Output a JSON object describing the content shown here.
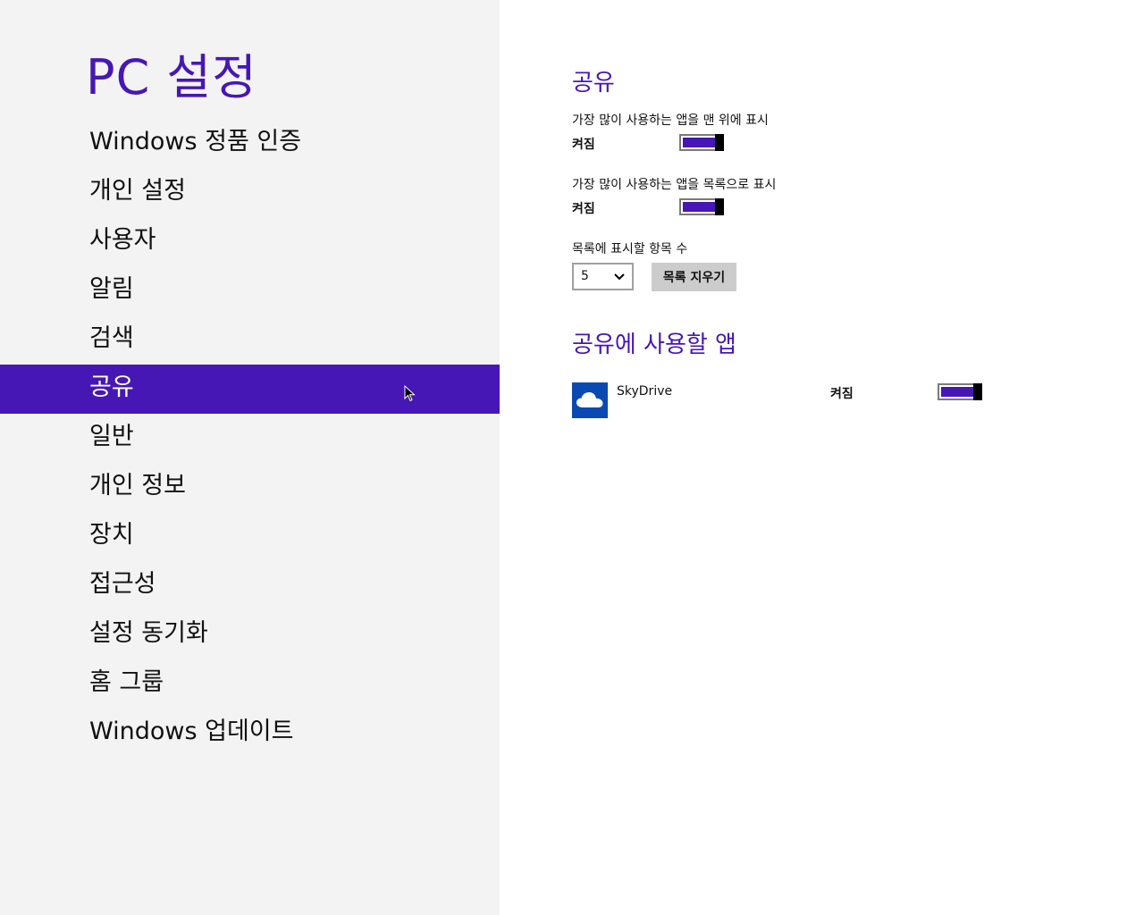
{
  "sidebar": {
    "title": "PC 설정",
    "items": [
      {
        "label": "Windows 정품 인증"
      },
      {
        "label": "개인 설정"
      },
      {
        "label": "사용자"
      },
      {
        "label": "알림"
      },
      {
        "label": "검색"
      },
      {
        "label": "공유",
        "selected": true
      },
      {
        "label": "일반"
      },
      {
        "label": "개인 정보"
      },
      {
        "label": "장치"
      },
      {
        "label": "접근성"
      },
      {
        "label": "설정 동기화"
      },
      {
        "label": "홈 그룹"
      },
      {
        "label": "Windows 업데이트"
      }
    ]
  },
  "main": {
    "section1_title": "공유",
    "setting1": {
      "label": "가장 많이 사용하는 앱을 맨 위에 표시",
      "state": "켜짐",
      "on": true
    },
    "setting2": {
      "label": "가장 많이 사용하는 앱을 목록으로 표시",
      "state": "켜짐",
      "on": true
    },
    "list_count": {
      "label": "목록에 표시할 항목 수",
      "value": "5"
    },
    "clear_button": "목록 지우기",
    "section2_title": "공유에 사용할 앱",
    "apps": [
      {
        "name": "SkyDrive",
        "state": "켜짐",
        "on": true,
        "icon": "cloud-icon"
      }
    ]
  },
  "colors": {
    "accent": "#4617b4",
    "sidebar_bg": "#f3f3f3",
    "app_tile": "#094ab2",
    "button_bg": "#cccccc"
  }
}
